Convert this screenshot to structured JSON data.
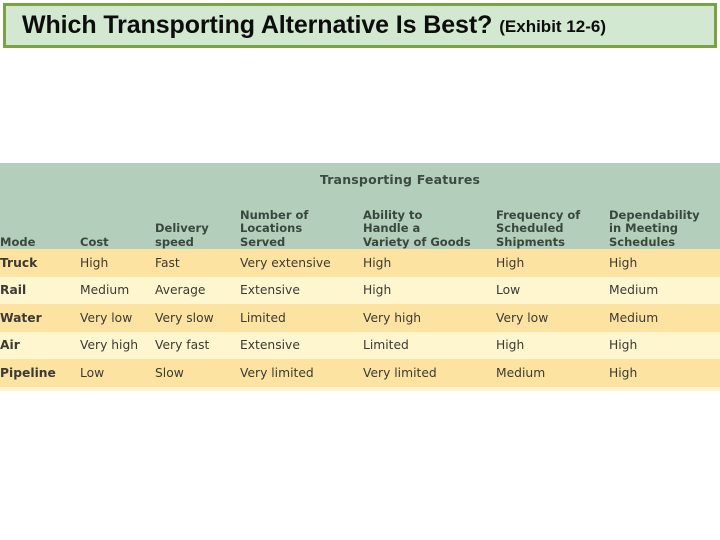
{
  "title": {
    "main": "Which Transporting Alternative Is Best?",
    "exhibit": "(Exhibit 12-6)"
  },
  "colors": {
    "banner_fill": "#d2e8d0",
    "banner_border": "#79a243",
    "table_header_green": "#b3cfbb",
    "row_odd_yellow": "#fce3a1",
    "row_even_yellow": "#fdf6cf",
    "rule": "#2f3b33"
  },
  "table": {
    "group_header": "Transporting Features",
    "columns": [
      {
        "id": "mode",
        "lines": [
          "Mode"
        ]
      },
      {
        "id": "cost",
        "lines": [
          "Cost"
        ]
      },
      {
        "id": "speed",
        "lines": [
          "Delivery",
          "speed"
        ]
      },
      {
        "id": "locations",
        "lines": [
          "Number of",
          "Locations",
          "Served"
        ]
      },
      {
        "id": "variety",
        "lines": [
          "Ability to",
          "Handle a",
          "Variety of Goods"
        ]
      },
      {
        "id": "frequency",
        "lines": [
          "Frequency of",
          "Scheduled",
          "Shipments"
        ]
      },
      {
        "id": "dependability",
        "lines": [
          "Dependability",
          "in Meeting",
          "Schedules"
        ]
      }
    ],
    "rows": [
      {
        "mode": "Truck",
        "cost": "High",
        "speed": "Fast",
        "locations": "Very extensive",
        "variety": "High",
        "frequency": "High",
        "dependability": "High"
      },
      {
        "mode": "Rail",
        "cost": "Medium",
        "speed": "Average",
        "locations": "Extensive",
        "variety": "High",
        "frequency": "Low",
        "dependability": "Medium"
      },
      {
        "mode": "Water",
        "cost": "Very low",
        "speed": "Very slow",
        "locations": "Limited",
        "variety": "Very high",
        "frequency": "Very low",
        "dependability": "Medium"
      },
      {
        "mode": "Air",
        "cost": "Very high",
        "speed": "Very fast",
        "locations": "Extensive",
        "variety": "Limited",
        "frequency": "High",
        "dependability": "High"
      },
      {
        "mode": "Pipeline",
        "cost": "Low",
        "speed": "Slow",
        "locations": "Very limited",
        "variety": "Very limited",
        "frequency": "Medium",
        "dependability": "High"
      }
    ]
  }
}
